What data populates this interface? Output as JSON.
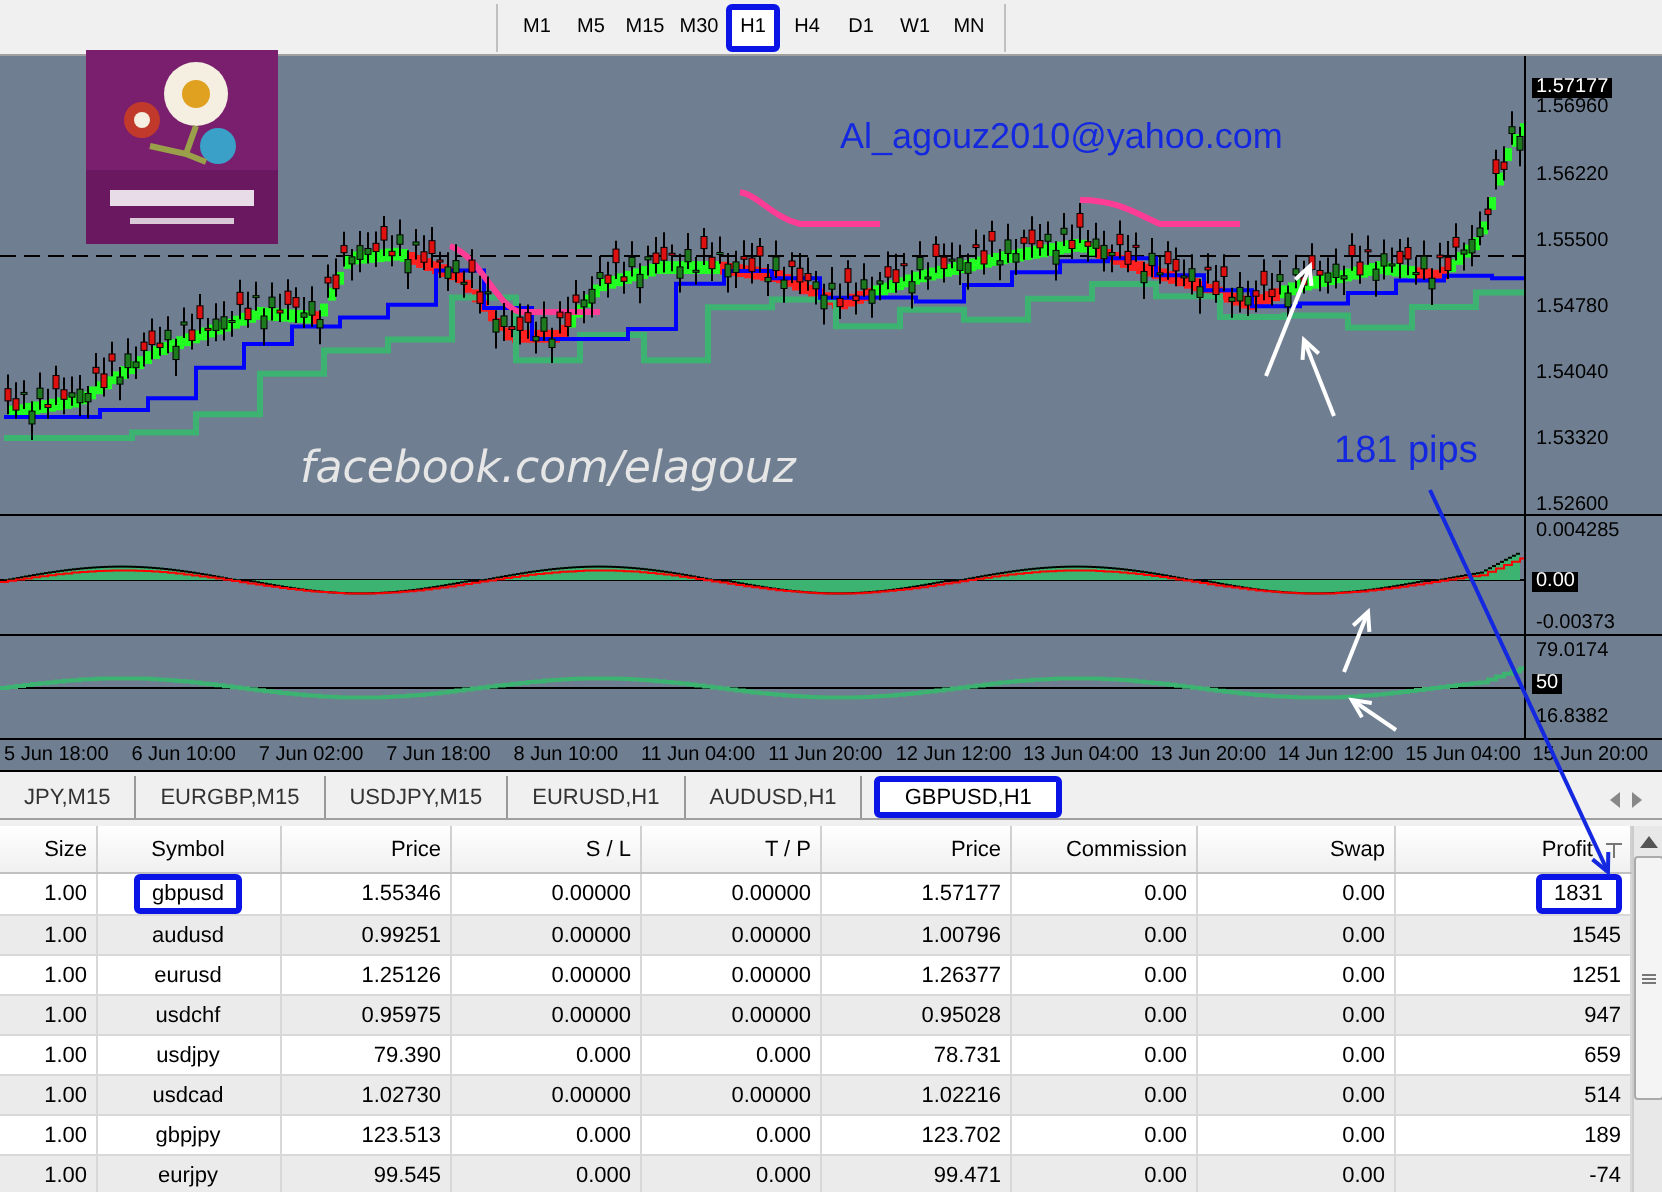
{
  "toolbar": {
    "timeframes": [
      {
        "label": "M1",
        "selected": false,
        "circled": false
      },
      {
        "label": "M5",
        "selected": false,
        "circled": false
      },
      {
        "label": "M15",
        "selected": false,
        "circled": false
      },
      {
        "label": "M30",
        "selected": false,
        "circled": false
      },
      {
        "label": "H1",
        "selected": true,
        "circled": true
      },
      {
        "label": "H4",
        "selected": false,
        "circled": false
      },
      {
        "label": "D1",
        "selected": false,
        "circled": false
      },
      {
        "label": "W1",
        "selected": false,
        "circled": false
      },
      {
        "label": "MN",
        "selected": false,
        "circled": false
      }
    ]
  },
  "chart": {
    "email_text": "Al_agouz2010@yahoo.com",
    "facebook_text": "facebook.com/elagouz",
    "pips_text": "181 pips",
    "price_axis": [
      {
        "label": "1.57177",
        "current": true
      },
      {
        "label": "1.56960",
        "current": false
      },
      {
        "label": "1.56220",
        "current": false
      },
      {
        "label": "1.55500",
        "current": false
      },
      {
        "label": "1.54780",
        "current": false
      },
      {
        "label": "1.54040",
        "current": false
      },
      {
        "label": "1.53320",
        "current": false
      },
      {
        "label": "1.52600",
        "current": false
      }
    ],
    "oscillator_axis": [
      {
        "label": "0.004285",
        "boxed": false
      },
      {
        "label": "0.00",
        "boxed": true
      },
      {
        "label": "-0.00373",
        "boxed": false
      }
    ],
    "rsi_axis": [
      {
        "label": "79.0174",
        "boxed": false
      },
      {
        "label": "50",
        "boxed": true
      },
      {
        "label": "16.8382",
        "boxed": false
      }
    ],
    "time_axis": [
      "5 Jun 18:00",
      "6 Jun 10:00",
      "7 Jun 02:00",
      "7 Jun 18:00",
      "8 Jun 10:00",
      "11 Jun 04:00",
      "11 Jun 20:00",
      "12 Jun 12:00",
      "13 Jun 04:00",
      "13 Jun 20:00",
      "14 Jun 12:00",
      "15 Jun 04:00",
      "15 Jun 20:00"
    ]
  },
  "chart_tabs": [
    {
      "label": "JPY,M15",
      "selected": false,
      "circled": false
    },
    {
      "label": "EURGBP,M15",
      "selected": false,
      "circled": false
    },
    {
      "label": "USDJPY,M15",
      "selected": false,
      "circled": false
    },
    {
      "label": "EURUSD,H1",
      "selected": false,
      "circled": false
    },
    {
      "label": "AUDUSD,H1",
      "selected": false,
      "circled": false
    },
    {
      "label": "GBPUSD,H1",
      "selected": true,
      "circled": true
    }
  ],
  "table": {
    "columns": [
      "Size",
      "Symbol",
      "Price",
      "S / L",
      "T / P",
      "Price",
      "Commission",
      "Swap",
      "Profit"
    ],
    "rows": [
      {
        "cells": [
          "1.00",
          "gbpusd",
          "1.55346",
          "0.00000",
          "0.00000",
          "1.57177",
          "0.00",
          "0.00",
          "1831"
        ],
        "symbol_circled": true,
        "profit_circled": true
      },
      {
        "cells": [
          "1.00",
          "audusd",
          "0.99251",
          "0.00000",
          "0.00000",
          "1.00796",
          "0.00",
          "0.00",
          "1545"
        ],
        "symbol_circled": false,
        "profit_circled": false
      },
      {
        "cells": [
          "1.00",
          "eurusd",
          "1.25126",
          "0.00000",
          "0.00000",
          "1.26377",
          "0.00",
          "0.00",
          "1251"
        ],
        "symbol_circled": false,
        "profit_circled": false
      },
      {
        "cells": [
          "1.00",
          "usdchf",
          "0.95975",
          "0.00000",
          "0.00000",
          "0.95028",
          "0.00",
          "0.00",
          "947"
        ],
        "symbol_circled": false,
        "profit_circled": false
      },
      {
        "cells": [
          "1.00",
          "usdjpy",
          "79.390",
          "0.000",
          "0.000",
          "78.731",
          "0.00",
          "0.00",
          "659"
        ],
        "symbol_circled": false,
        "profit_circled": false
      },
      {
        "cells": [
          "1.00",
          "usdcad",
          "1.02730",
          "0.00000",
          "0.00000",
          "1.02216",
          "0.00",
          "0.00",
          "514"
        ],
        "symbol_circled": false,
        "profit_circled": false
      },
      {
        "cells": [
          "1.00",
          "gbpjpy",
          "123.513",
          "0.000",
          "0.000",
          "123.702",
          "0.00",
          "0.00",
          "189"
        ],
        "symbol_circled": false,
        "profit_circled": false
      },
      {
        "cells": [
          "1.00",
          "eurjpy",
          "99.545",
          "0.000",
          "0.000",
          "99.471",
          "0.00",
          "0.00",
          "-74"
        ],
        "symbol_circled": false,
        "profit_circled": false
      }
    ]
  }
}
